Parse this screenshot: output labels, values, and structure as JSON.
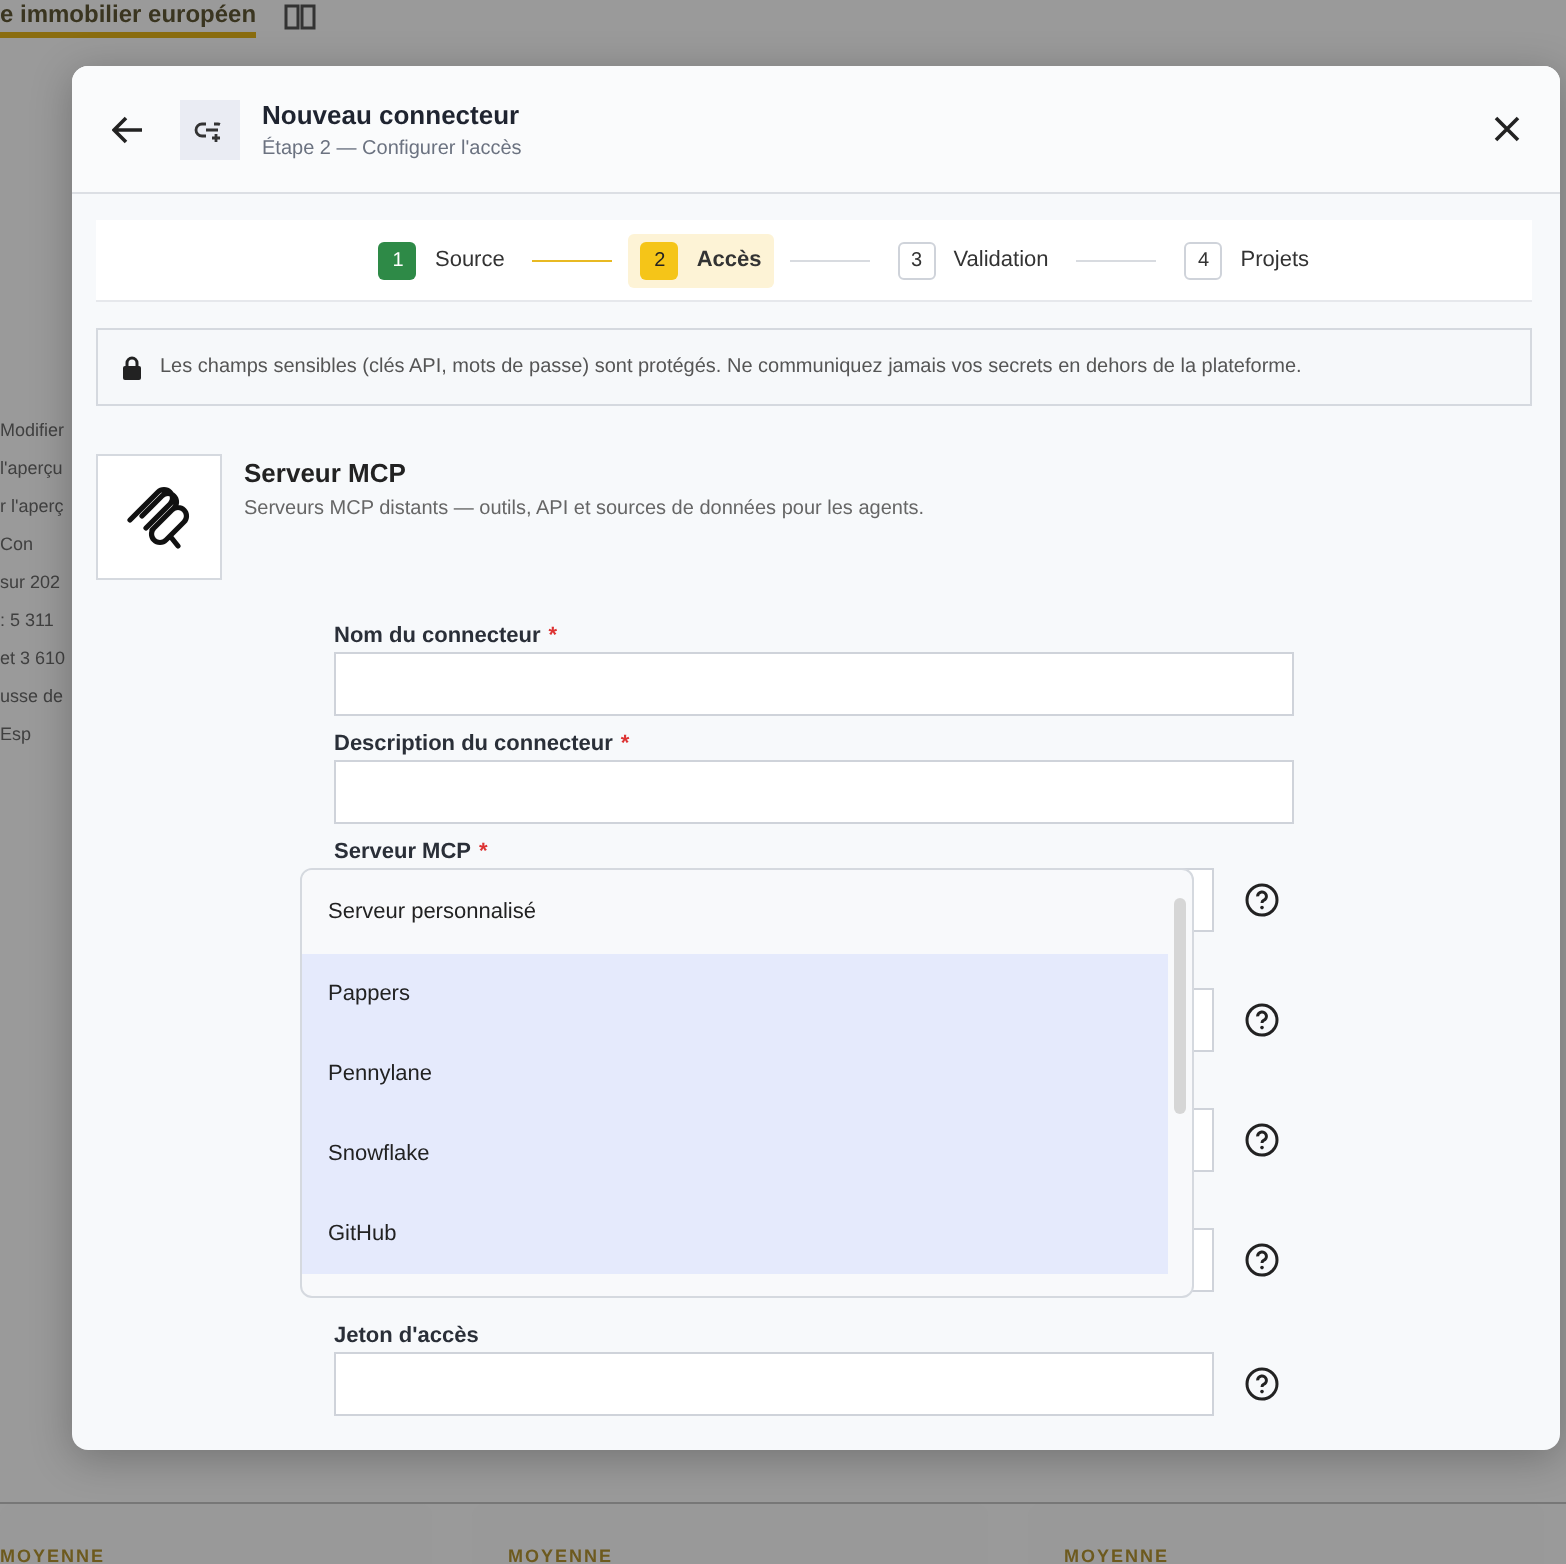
{
  "background_page": {
    "title": "e immobilier européen",
    "side_fragments": [
      "Modifier",
      "l'aperçu",
      "r l'aperç",
      "Con",
      "sur 202",
      ": 5 311",
      "et 3 610",
      "usse de",
      "Esp"
    ],
    "card_labels": [
      "MOYENNE",
      "MOYENNE",
      "MOYENNE"
    ]
  },
  "dialog": {
    "title": "Nouveau connecteur",
    "subtitle": "Étape 2 — Configurer l'accès",
    "steps": [
      {
        "number": "1",
        "label": "Source",
        "done": true,
        "selected": false
      },
      {
        "number": "2",
        "label": "Accès",
        "done": false,
        "selected": true
      },
      {
        "number": "3",
        "label": "Validation",
        "done": false,
        "selected": false
      },
      {
        "number": "4",
        "label": "Projets",
        "done": false,
        "selected": false
      }
    ],
    "notice": "Les champs sensibles (clés API, mots de passe) sont protégés. Ne communiquez jamais vos secrets en dehors de la plateforme.",
    "connector": {
      "name": "Serveur MCP",
      "description": "Serveurs MCP distants — outils, API et sources de données pour les agents."
    },
    "fields": [
      {
        "label": "Nom du connecteur",
        "required_mark": "*",
        "kind": "text"
      },
      {
        "label": "Description du connecteur",
        "required_mark": "*",
        "kind": "text"
      }
    ],
    "server_field": {
      "label": "Serveur MCP",
      "required_mark": "*",
      "options": [
        {
          "label": "Serveur personnalisé",
          "highlighted": false
        },
        {
          "label": "Pappers",
          "highlighted": true
        },
        {
          "label": "Pennylane",
          "highlighted": true
        },
        {
          "label": "Snowflake",
          "highlighted": true
        },
        {
          "label": "GitHub",
          "highlighted": true
        }
      ]
    },
    "help_fields": [
      {
        "label": "Jeton d'accès"
      }
    ]
  }
}
